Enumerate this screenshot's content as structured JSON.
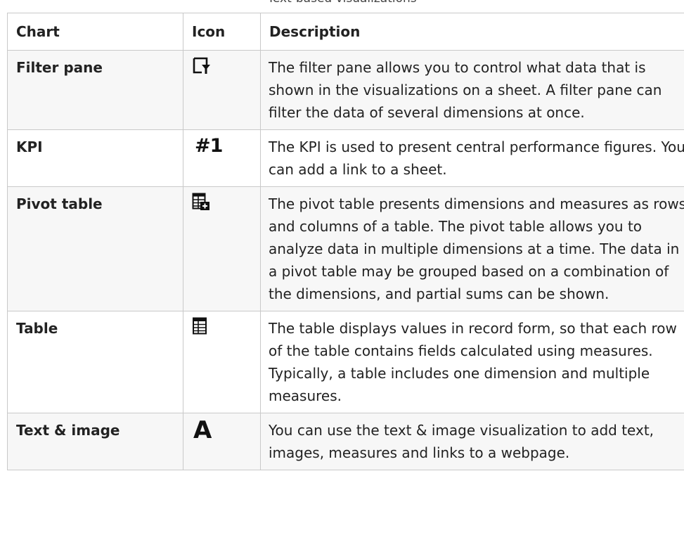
{
  "caption": "Text-based visualizations",
  "columns": {
    "chart": "Chart",
    "icon": "Icon",
    "description": "Description"
  },
  "rows": [
    {
      "chart": "Filter pane",
      "icon": "filter-pane-icon",
      "description": "The filter pane allows you to control what data that is shown in the visualizations on a sheet. A filter pane can filter the data of several dimensions at once."
    },
    {
      "chart": "KPI",
      "icon": "kpi-icon",
      "icon_text": "#1",
      "description": "The KPI is used to present central performance figures. You can add a link to a sheet."
    },
    {
      "chart": "Pivot table",
      "icon": "pivot-table-icon",
      "description": "The pivot table presents dimensions and measures as rows and columns of a table. The pivot table allows you to analyze data in multiple dimensions at a time. The data in a pivot table may be grouped based on a combination of the dimensions, and partial sums can be shown."
    },
    {
      "chart": "Table",
      "icon": "table-icon",
      "description": "The table displays values in record form, so that each row of the table contains fields calculated using measures. Typically, a table includes one dimension and multiple measures."
    },
    {
      "chart": "Text & image",
      "icon": "text-image-icon",
      "icon_text": "A",
      "description": "You can use the text & image visualization to add text, images, measures and links to a webpage."
    }
  ]
}
